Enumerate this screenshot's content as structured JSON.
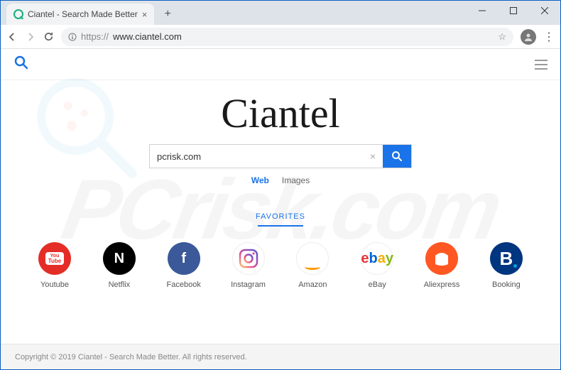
{
  "browser": {
    "tab_title": "Ciantel - Search Made Better",
    "url_protocol": "https://",
    "url_host": "www.ciantel.com"
  },
  "page": {
    "logo_text": "Ciantel",
    "search_value": "pcrisk.com",
    "search_tabs": {
      "web": "Web",
      "images": "Images"
    },
    "favorites_header": "FAVORITES",
    "favorites": [
      {
        "label": "Youtube"
      },
      {
        "label": "Netflix"
      },
      {
        "label": "Facebook"
      },
      {
        "label": "Instagram"
      },
      {
        "label": "Amazon"
      },
      {
        "label": "eBay"
      },
      {
        "label": "Aliexpress"
      },
      {
        "label": "Booking"
      }
    ],
    "footer": "Copyright © 2019 Ciantel - Search Made Better. All rights reserved."
  },
  "watermark": "PCrisk.com"
}
